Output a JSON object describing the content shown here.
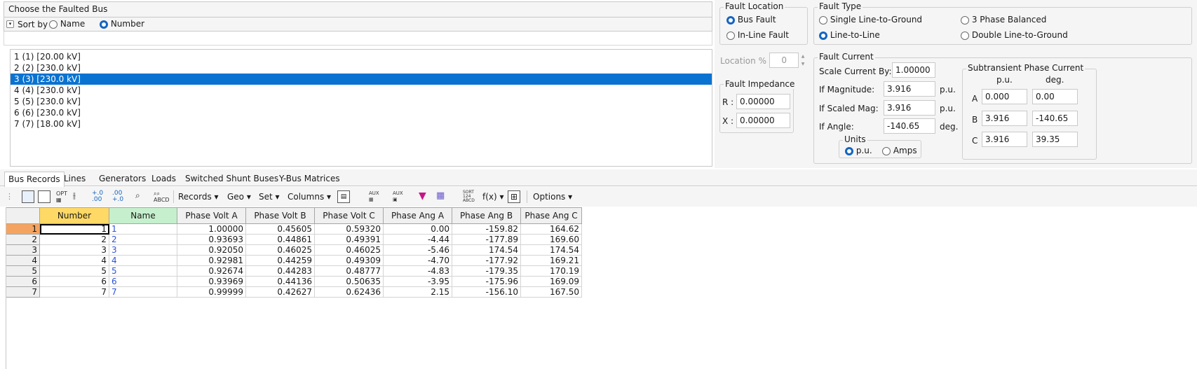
{
  "faulted_bus": {
    "title": "Choose the Faulted Bus",
    "sort_by_label": "Sort by",
    "sort_options": [
      {
        "label": "Name",
        "selected": false
      },
      {
        "label": "Number",
        "selected": true
      }
    ],
    "buses": [
      {
        "text": "1 (1)  [20.00 kV]",
        "selected": false
      },
      {
        "text": "2 (2)  [230.0 kV]",
        "selected": false
      },
      {
        "text": "3 (3)  [230.0 kV]",
        "selected": true
      },
      {
        "text": "4 (4)  [230.0 kV]",
        "selected": false
      },
      {
        "text": "5 (5)  [230.0 kV]",
        "selected": false
      },
      {
        "text": "6 (6)  [230.0 kV]",
        "selected": false
      },
      {
        "text": "7 (7)  [18.00 kV]",
        "selected": false
      }
    ]
  },
  "fault_location": {
    "title": "Fault Location",
    "bus_fault": "Bus Fault",
    "inline_fault": "In-Line Fault",
    "selected": "Bus Fault",
    "location_label": "Location %",
    "location_value": "0"
  },
  "fault_impedance": {
    "title": "Fault Impedance",
    "r_label": "R :",
    "r_value": "0.00000",
    "x_label": "X :",
    "x_value": "0.00000"
  },
  "fault_type": {
    "title": "Fault Type",
    "options": [
      "Single Line-to-Ground",
      "3 Phase Balanced",
      "Line-to-Line",
      "Double Line-to-Ground"
    ],
    "selected": "Line-to-Line"
  },
  "fault_current": {
    "title": "Fault Current",
    "scale_label": "Scale Current By:",
    "scale_value": "1.00000",
    "mag_label": "If Magnitude:",
    "mag_value": "3.916",
    "mag_unit": "p.u.",
    "scaled_label": "If Scaled Mag:",
    "scaled_value": "3.916",
    "scaled_unit": "p.u.",
    "angle_label": "If Angle:",
    "angle_value": "-140.65",
    "angle_unit": "deg.",
    "units_title": "Units",
    "units_pu": "p.u.",
    "units_amps": "Amps",
    "units_selected": "p.u."
  },
  "subtransient": {
    "title": "Subtransient Phase Current",
    "col_pu": "p.u.",
    "col_deg": "deg.",
    "phases": [
      {
        "label": "A",
        "pu": "0.000",
        "deg": "0.00"
      },
      {
        "label": "B",
        "pu": "3.916",
        "deg": "-140.65"
      },
      {
        "label": "C",
        "pu": "3.916",
        "deg": "39.35"
      }
    ]
  },
  "tabs": [
    "Bus Records",
    "Lines",
    "Generators",
    "Loads",
    "Switched Shunt Buses",
    "Y-Bus Matrices"
  ],
  "active_tab": "Bus Records",
  "toolbar": {
    "records": "Records ▾",
    "geo": "Geo ▾",
    "set": "Set ▾",
    "columns": "Columns ▾",
    "fx": "f(x) ▾",
    "options": "Options ▾"
  },
  "grid": {
    "columns": [
      "Number",
      "Name",
      "Phase Volt A",
      "Phase Volt B",
      "Phase Volt C",
      "Phase Ang A",
      "Phase Ang B",
      "Phase Ang C"
    ],
    "rows": [
      {
        "row": "1",
        "number": "1",
        "name": "1",
        "va": "1.00000",
        "vb": "0.45605",
        "vc": "0.59320",
        "aa": "0.00",
        "ab": "-159.82",
        "ac": "164.62"
      },
      {
        "row": "2",
        "number": "2",
        "name": "2",
        "va": "0.93693",
        "vb": "0.44861",
        "vc": "0.49391",
        "aa": "-4.44",
        "ab": "-177.89",
        "ac": "169.60"
      },
      {
        "row": "3",
        "number": "3",
        "name": "3",
        "va": "0.92050",
        "vb": "0.46025",
        "vc": "0.46025",
        "aa": "-5.46",
        "ab": "174.54",
        "ac": "174.54"
      },
      {
        "row": "4",
        "number": "4",
        "name": "4",
        "va": "0.92981",
        "vb": "0.44259",
        "vc": "0.49309",
        "aa": "-4.70",
        "ab": "-177.92",
        "ac": "169.21"
      },
      {
        "row": "5",
        "number": "5",
        "name": "5",
        "va": "0.92674",
        "vb": "0.44283",
        "vc": "0.48777",
        "aa": "-4.83",
        "ab": "-179.35",
        "ac": "170.19"
      },
      {
        "row": "6",
        "number": "6",
        "name": "6",
        "va": "0.93969",
        "vb": "0.44136",
        "vc": "0.50635",
        "aa": "-3.95",
        "ab": "-175.96",
        "ac": "169.09"
      },
      {
        "row": "7",
        "number": "7",
        "name": "7",
        "va": "0.99999",
        "vb": "0.42627",
        "vc": "0.62436",
        "aa": "2.15",
        "ab": "-156.10",
        "ac": "167.50"
      }
    ]
  },
  "colors": {
    "selection": "#0a73d1",
    "radio_on": "#1565c0",
    "number_header": "#ffd966",
    "name_header": "#c6efce",
    "row_marker": "#f4a460",
    "link_text": "#2e53d6"
  }
}
